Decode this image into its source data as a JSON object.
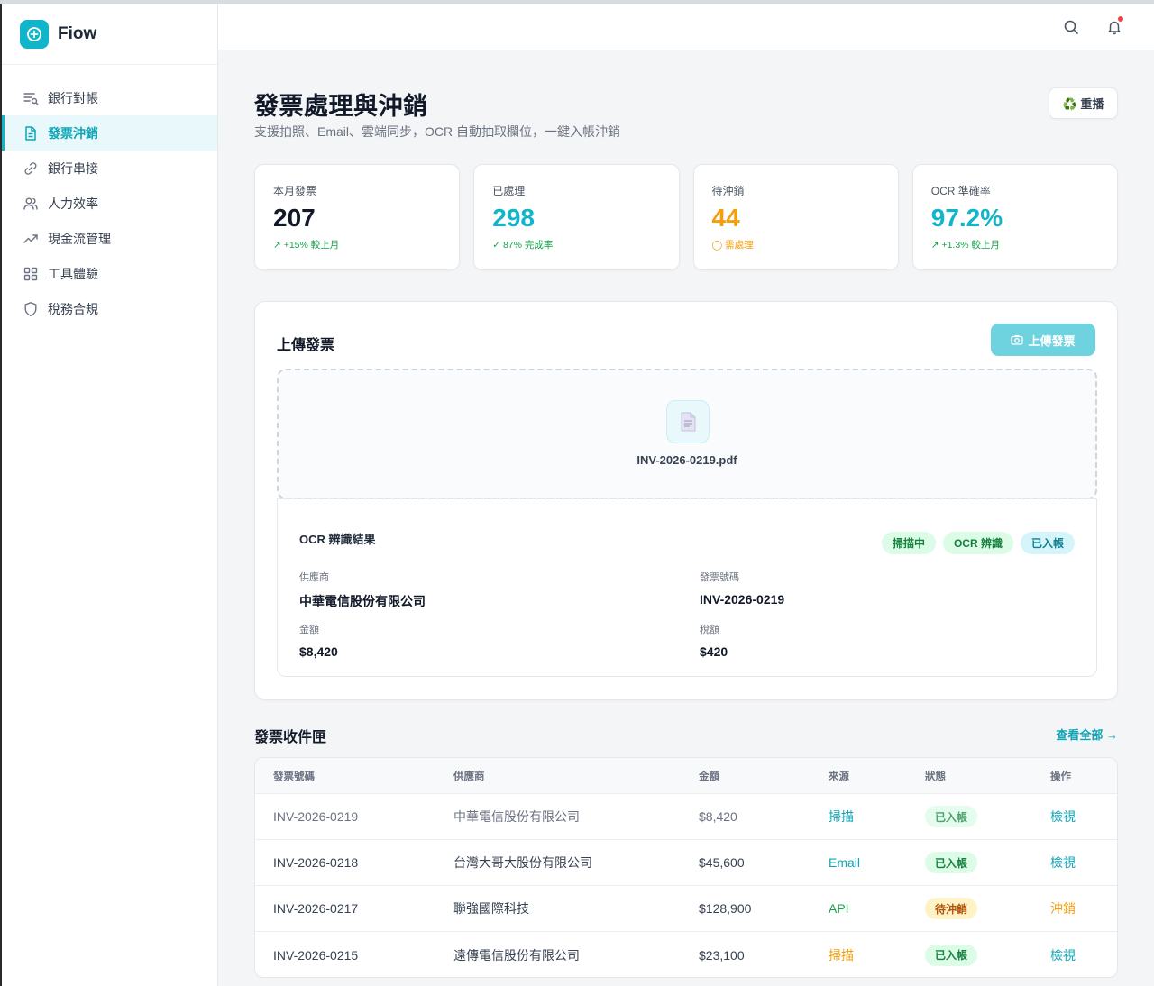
{
  "app": {
    "name": "Fiow"
  },
  "sidebar": {
    "items": [
      {
        "label": "銀行對帳",
        "icon": "list-search-icon",
        "active": false
      },
      {
        "label": "發票沖銷",
        "icon": "document-icon",
        "active": true
      },
      {
        "label": "銀行串接",
        "icon": "link-icon",
        "active": false
      },
      {
        "label": "人力效率",
        "icon": "users-icon",
        "active": false
      },
      {
        "label": "現金流管理",
        "icon": "trending-up-icon",
        "active": false
      },
      {
        "label": "工具體驗",
        "icon": "grid-icon",
        "active": false
      },
      {
        "label": "稅務合規",
        "icon": "shield-icon",
        "active": false
      }
    ]
  },
  "header": {
    "title": "發票處理與沖銷",
    "subtitle": "支援拍照、Email、雲端同步，OCR 自動抽取欄位，一鍵入帳沖銷",
    "replay_label": "♻️ 重播"
  },
  "stats": [
    {
      "label": "本月發票",
      "value": "207",
      "note": "↗ +15% 較上月",
      "color": "#111827",
      "note_color": "#16a34a"
    },
    {
      "label": "已處理",
      "value": "298",
      "note": "✓ 87% 完成率",
      "color": "#11b5c9",
      "note_color": "#16a34a"
    },
    {
      "label": "待沖銷",
      "value": "44",
      "note": "◯ 需處理",
      "color": "#f59e0b",
      "note_color": "#f59e0b"
    },
    {
      "label": "OCR 準確率",
      "value": "97.2%",
      "note": "↗ +1.3% 較上月",
      "color": "#11b5c9",
      "note_color": "#16a34a"
    }
  ],
  "upload": {
    "title": "上傳發票",
    "button_label": "上傳發票",
    "file_name": "INV-2026-0219.pdf",
    "ocr": {
      "title": "OCR 辨識結果",
      "chips": [
        "掃描中",
        "OCR 辨識",
        "已入帳"
      ],
      "supplier_label": "供應商",
      "supplier": "中華電信股份有限公司",
      "invoice_no_label": "發票號碼",
      "invoice_no": "INV-2026-0219",
      "amount_label": "金額",
      "amount": "$8,420",
      "tax_label": "稅額",
      "tax": "$420"
    }
  },
  "inbox": {
    "title": "發票收件匣",
    "view_all": "查看全部 →",
    "columns": [
      "發票號碼",
      "供應商",
      "金額",
      "來源",
      "狀態",
      "操作"
    ],
    "rows": [
      {
        "no": "INV-2026-0219",
        "supplier": "中華電信股份有限公司",
        "amount": "$8,420",
        "source": "掃描",
        "status": "已入帳",
        "action": "檢視"
      },
      {
        "no": "INV-2026-0218",
        "supplier": "台灣大哥大股份有限公司",
        "amount": "$45,600",
        "source": "Email",
        "status": "已入帳",
        "action": "檢視"
      },
      {
        "no": "INV-2026-0217",
        "supplier": "聯強國際科技",
        "amount": "$128,900",
        "source": "API",
        "status": "待沖銷",
        "action": "沖銷"
      },
      {
        "no": "INV-2026-0215",
        "supplier": "遠傳電信股份有限公司",
        "amount": "$23,100",
        "source": "掃描",
        "status": "已入帳",
        "action": "檢視"
      }
    ]
  }
}
